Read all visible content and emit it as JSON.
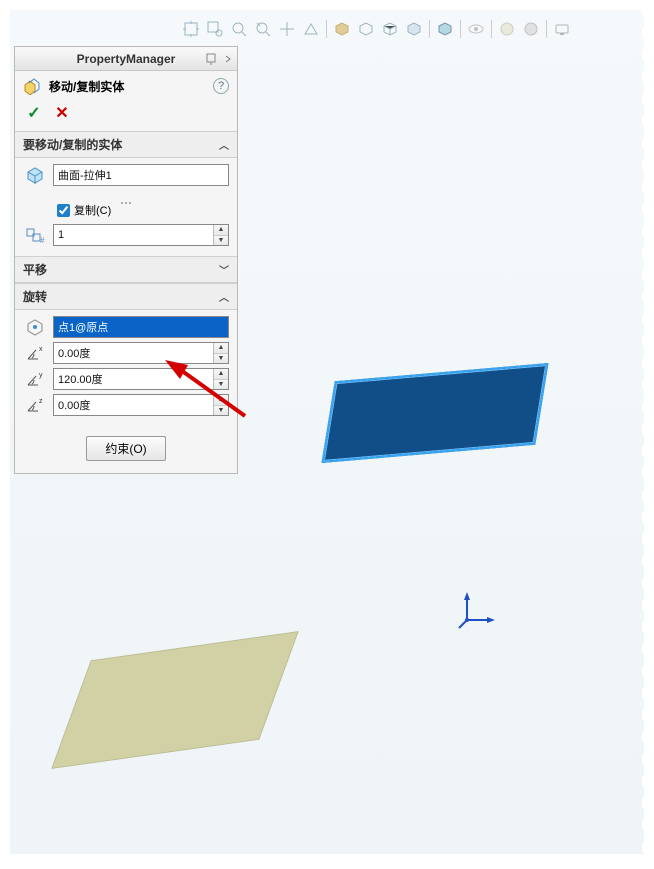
{
  "panel": {
    "title": "PropertyManager",
    "command_name": "移动/复制实体",
    "help_glyph": "?"
  },
  "sections": {
    "entities": {
      "title": "要移动/复制的实体",
      "item": "曲面-拉伸1",
      "copy_label": "复制(C)",
      "copy_checked": true,
      "count": "1"
    },
    "translate": {
      "title": "平移"
    },
    "rotate": {
      "title": "旋转",
      "reference": "点1@原点",
      "angle_x": "0.00度",
      "angle_y": "120.00度",
      "angle_z": "0.00度"
    }
  },
  "buttons": {
    "constraint": "约束(O)"
  },
  "colors": {
    "accent": "#0a64c8"
  }
}
